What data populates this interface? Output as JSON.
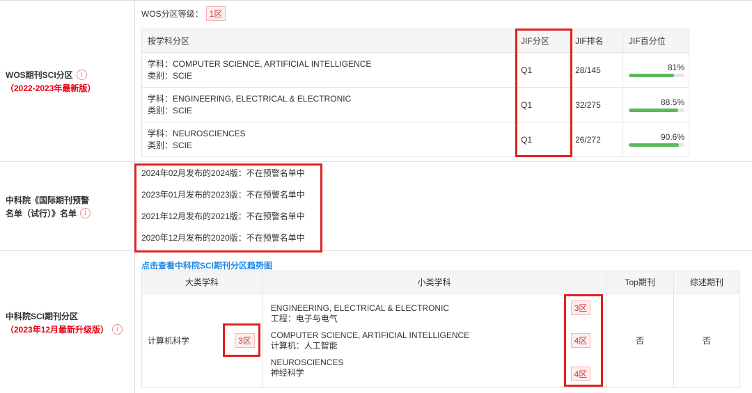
{
  "wos": {
    "label_line1": "WOS期刊SCI分区",
    "label_line2": "（2022-2023年最新版）",
    "grade_label": "WOS分区等级：",
    "grade_value": "1区",
    "headers": [
      "按学科分区",
      "JIF分区",
      "JIF排名",
      "JIF百分位"
    ],
    "rows": [
      {
        "subject": "学科：COMPUTER SCIENCE, ARTIFICIAL INTELLIGENCE",
        "category": "类别：SCIE",
        "quartile": "Q1",
        "rank": "28/145",
        "percentile_text": "81%",
        "percentile": 81
      },
      {
        "subject": "学科：ENGINEERING, ELECTRICAL & ELECTRONIC",
        "category": "类别：SCIE",
        "quartile": "Q1",
        "rank": "32/275",
        "percentile_text": "88.5%",
        "percentile": 88.5
      },
      {
        "subject": "学科：NEUROSCIENCES",
        "category": "类别：SCIE",
        "quartile": "Q1",
        "rank": "26/272",
        "percentile_text": "90.6%",
        "percentile": 90.6
      }
    ]
  },
  "warning": {
    "label_line1": "中科院《国际期刊预警",
    "label_line2": "名单（试行）》名单",
    "items": [
      "2024年02月发布的2024版：不在预警名单中",
      "2023年01月发布的2023版：不在预警名单中",
      "2021年12月发布的2021版：不在预警名单中",
      "2020年12月发布的2020版：不在预警名单中"
    ]
  },
  "cas": {
    "label_line1": "中科院SCI期刊分区",
    "label_line2": "（2023年12月最新升级版）",
    "trend_link": "点击查看中科院SCI期刊分区趋势图",
    "headers": [
      "大类学科",
      "小类学科",
      "Top期刊",
      "综述期刊"
    ],
    "major": "计算机科学",
    "major_zone": "3区",
    "minors": [
      {
        "en": "ENGINEERING, ELECTRICAL & ELECTRONIC",
        "cn": "工程：电子与电气",
        "zone": "3区"
      },
      {
        "en": "COMPUTER SCIENCE, ARTIFICIAL INTELLIGENCE",
        "cn": "计算机：人工智能",
        "zone": "4区"
      },
      {
        "en": "NEUROSCIENCES",
        "cn": "神经科学",
        "zone": "4区"
      }
    ],
    "top": "否",
    "review": "否"
  },
  "info_icon": "info-icon",
  "colors": {
    "accent_red": "#e60012",
    "link_blue": "#1e88e5",
    "bar_green": "#5cb85c"
  }
}
